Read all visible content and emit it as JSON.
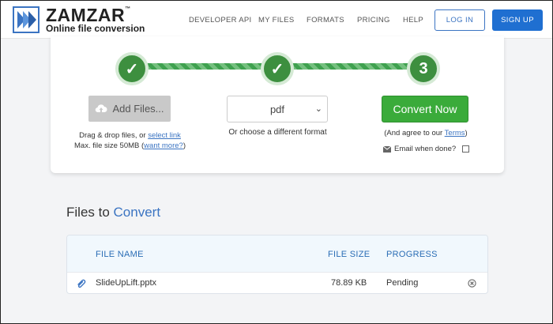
{
  "header": {
    "brand": "ZAMZAR",
    "brand_tm": "™",
    "tagline": "Online file conversion",
    "nav": [
      "DEVELOPER API",
      "MY FILES",
      "FORMATS",
      "PRICING",
      "HELP"
    ],
    "login_label": "LOG IN",
    "signup_label": "SIGN UP"
  },
  "converter": {
    "steps": [
      {
        "state": "done",
        "glyph": "✓"
      },
      {
        "state": "done",
        "glyph": "✓"
      },
      {
        "state": "current",
        "glyph": "3"
      }
    ],
    "add_files_label": "Add Files...",
    "drag_prefix": "Drag & drop files, or ",
    "select_link": "select link",
    "max_prefix": "Max. file size 50MB (",
    "want_more": "want more?",
    "max_suffix": ")",
    "format_value": "pdf",
    "format_hint": "Or choose a different format",
    "convert_label": "Convert Now",
    "agree_prefix": "(And agree to our ",
    "terms_link": "Terms",
    "agree_suffix": ")",
    "email_label": "Email when done?"
  },
  "files": {
    "heading_prefix": "Files to ",
    "heading_highlight": "Convert",
    "columns": {
      "name": "FILE NAME",
      "size": "FILE SIZE",
      "progress": "PROGRESS"
    },
    "rows": [
      {
        "name": "SlideUpLift.pptx",
        "size": "78.89 KB",
        "progress": "Pending"
      }
    ]
  },
  "colors": {
    "accent": "#3b74c2",
    "signup_bg": "#1f6fd1",
    "success": "#3aab3a",
    "step": "#3d8f3f"
  },
  "icons": [
    "zamzar-logo-icon",
    "upload-cloud-icon",
    "chevron-down-icon",
    "envelope-icon",
    "paperclip-icon",
    "remove-circle-icon",
    "check-icon"
  ]
}
